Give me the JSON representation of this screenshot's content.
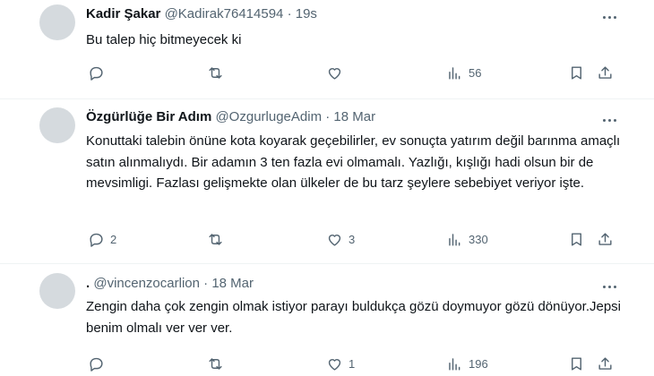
{
  "tweets": [
    {
      "name": "Kadir Şakar",
      "handle": "@Kadirak76414594",
      "time": "19s",
      "text": "Bu talep hiç bitmeyecek ki",
      "replies": "",
      "retweets": "",
      "likes": "",
      "views": "56"
    },
    {
      "name": "Özgürlüğe Bir Adım",
      "handle": "@OzgurlugeAdim",
      "time": "18 Mar",
      "text": "Konuttaki talebin önüne kota koyarak geçebilirler, ev sonuçta yatırım değil barınma amaçlı satın alınmalıydı. Bir adamın 3 ten fazla evi olmamalı. Yazlığı, kışlığı hadi olsun bir de mevsimligi. Fazlası gelişmekte olan ülkeler de bu tarz şeylere sebebiyet veriyor işte.",
      "replies": "2",
      "retweets": "",
      "likes": "3",
      "views": "330"
    },
    {
      "name": ".",
      "handle": "@vincenzocarlion",
      "time": "18 Mar",
      "text": "Zengin daha çok zengin olmak istiyor parayı buldukça gözü doymuyor gözü dönüyor.Jepsi benim olmalı ver ver ver.",
      "replies": "",
      "retweets": "",
      "likes": "1",
      "views": "196"
    }
  ],
  "separator": "·",
  "icons": [
    "reply-icon",
    "retweet-icon",
    "like-icon",
    "views-icon",
    "bookmark-icon",
    "share-icon",
    "more-icon"
  ],
  "colors": {
    "text": "#0f1419",
    "secondary": "#536471",
    "divider": "#eff3f4",
    "avatar": "#d5dade"
  }
}
